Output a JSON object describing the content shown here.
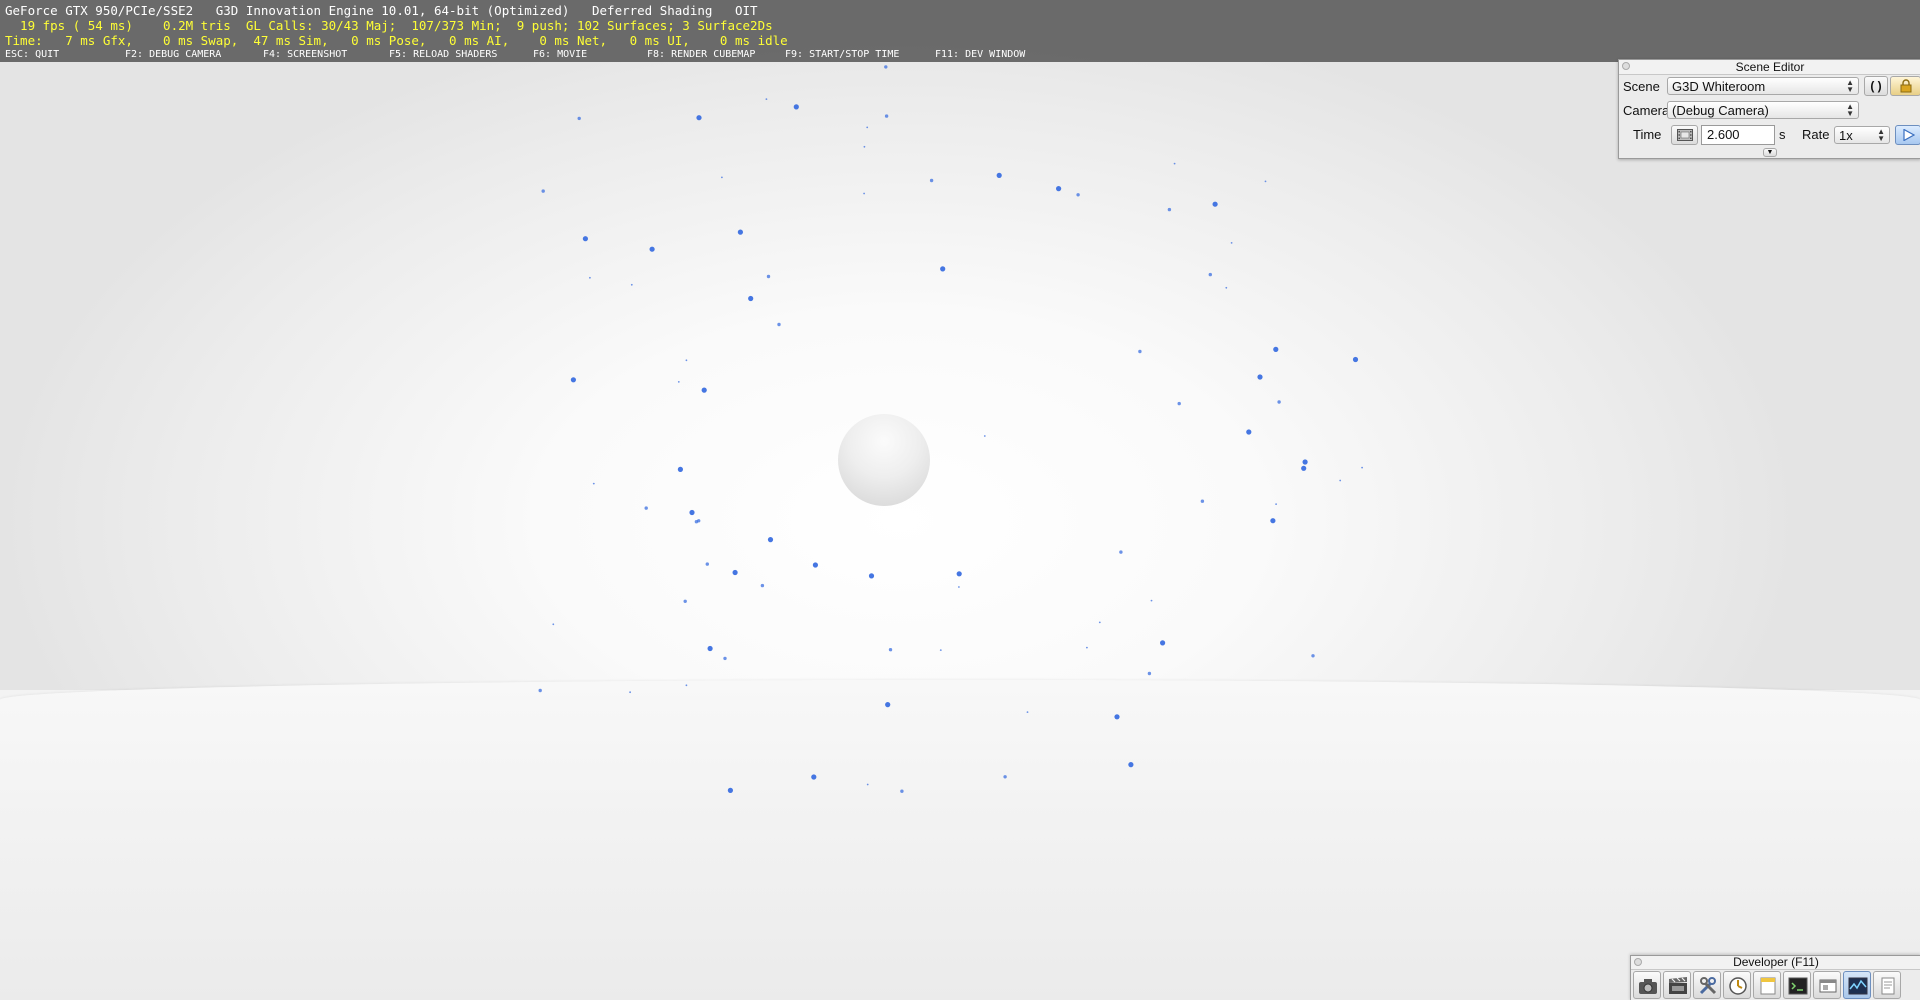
{
  "hud": {
    "line1": "GeForce GTX 950/PCIe/SSE2   G3D Innovation Engine 10.01, 64-bit (Optimized)   Deferred Shading   OIT",
    "line2": "  19 fps ( 54 ms)    0.2M tris  GL Calls: 30/43 Maj;  107/373 Min;  9 push; 102 Surfaces; 3 Surface2Ds",
    "line3": "Time:   7 ms Gfx,    0 ms Swap,  47 ms Sim,   0 ms Pose,   0 ms AI,    0 ms Net,   0 ms UI,    0 ms idle",
    "keys": [
      "ESC: QUIT",
      "F2: DEBUG CAMERA",
      "F4: SCREENSHOT",
      "F5: RELOAD SHADERS",
      "F6: MOVIE",
      "F8: RENDER CUBEMAP",
      "F9: START/STOP TIME",
      "F11: DEV WINDOW"
    ],
    "colors": {
      "primary_text": "#ffffff",
      "stats_text": "#ffff36",
      "bar": "#606060"
    }
  },
  "scene_editor": {
    "title": "Scene Editor",
    "scene_label": "Scene",
    "scene_value": "G3D Whiteroom",
    "reload_icon": "reload-icon",
    "lock_icon": "lock-icon",
    "camera_label": "Camera",
    "camera_value": "(Debug Camera)",
    "time_label": "Time",
    "time_value": "2.600",
    "time_unit": "s",
    "rate_label": "Rate",
    "rate_value": "1x",
    "play_icon": "play-icon",
    "film_icon": "film-icon",
    "expand_icon": "expand-arrow-icon"
  },
  "developer": {
    "title": "Developer (F11)",
    "tools": [
      "camera-icon",
      "movie-clapper-icon",
      "wrench-icon",
      "clock-icon",
      "notes-icon",
      "terminal-icon",
      "window-icon",
      "profiler-icon",
      "page-icon"
    ]
  },
  "scene": {
    "accent": "#3b6fe0",
    "sphere_color": "#e9e9e9"
  }
}
